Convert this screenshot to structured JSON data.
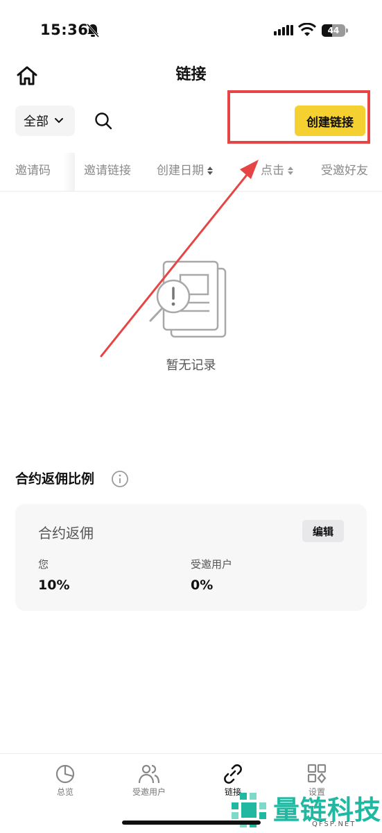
{
  "status_bar": {
    "time": "15:36",
    "battery": "44",
    "battery_level": 0.44
  },
  "header": {
    "title": "链接",
    "home_icon": "home-icon"
  },
  "toolbar": {
    "filter_label": "全部",
    "search_icon": "search-icon",
    "create_button": "创建链接"
  },
  "table": {
    "columns": [
      "邀请码",
      "邀请链接",
      "创建日期",
      "点击",
      "受邀好友"
    ]
  },
  "empty_state": {
    "text": "暂无记录",
    "icon": "empty-document-icon"
  },
  "rebate": {
    "section_title": "合约返佣比例",
    "info_icon": "info-icon",
    "card_title": "合约返佣",
    "edit_button": "编辑",
    "you_label": "您",
    "you_value": "10%",
    "invitee_label": "受邀用户",
    "invitee_value": "0%"
  },
  "bottom_nav": {
    "items": [
      {
        "label": "总览",
        "icon": "pie-chart-icon"
      },
      {
        "label": "受邀用户",
        "icon": "users-icon"
      },
      {
        "label": "链接",
        "icon": "link-icon",
        "active": true
      },
      {
        "label": "设置",
        "icon": "grid-icon"
      }
    ]
  },
  "watermark": {
    "text": "量链科技",
    "sub": "QFSP.NET"
  },
  "colors": {
    "accent": "#F4D030",
    "annotation": "#E64545",
    "watermark": "#20B8A0"
  }
}
